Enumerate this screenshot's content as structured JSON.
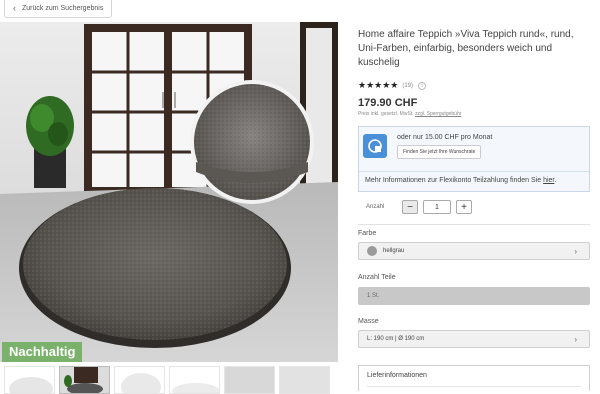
{
  "nav": {
    "back_label": "Zurück zum Suchergebnis"
  },
  "gallery": {
    "badge": "Nachhaltig"
  },
  "product": {
    "title": "Home affaire Teppich »Viva Teppich rund«, rund, Uni-Farben, einfarbig, besonders weich und kuschelig",
    "stars": "★★★★★",
    "rating_count": "(19)",
    "price": "179.90 CHF",
    "price_note_prefix": "Preis inkl. gesetzl. MwSt.",
    "price_note_link": "zzgl. Sperrgutgebühr"
  },
  "finance": {
    "offer": "oder nur 15.00 CHF pro Monat",
    "button": "Finden Sie jetzt Ihre Wunschrate",
    "more_prefix": "Mehr Informationen zur Flexikonto Teilzahlung finden Sie",
    "more_link": "hier",
    "more_suffix": "."
  },
  "quantity": {
    "label": "Anzahl",
    "minus": "−",
    "value": "1",
    "plus": "+"
  },
  "options": {
    "color_label": "Farbe",
    "color_value": "hellgrau",
    "parts_label": "Anzahl Teile",
    "parts_value": "1 St.",
    "size_label": "Masse",
    "size_value": "L: 190 cm | Ø 190 cm",
    "chevron": "›"
  },
  "delivery": {
    "label": "Lieferinformationen"
  },
  "colors": {
    "badge_green": "#7bb26b",
    "finance_bg": "#f4f8fd",
    "finance_icon": "#4a90d9"
  }
}
